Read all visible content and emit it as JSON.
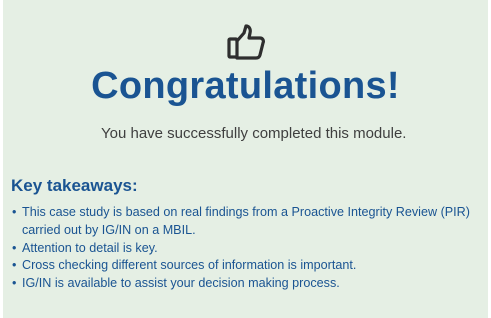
{
  "colors": {
    "panel_background": "#e5efe4",
    "accent": "#1a5492",
    "body_text": "#3f3f3f"
  },
  "icon": {
    "name": "thumbs-up-icon"
  },
  "main": {
    "title": "Congratulations!",
    "subtitle": "You have successfully completed this module."
  },
  "takeaways": {
    "heading": "Key takeaways:",
    "items": [
      "This case study is based on real findings from a Proactive Integrity Review (PIR) carried out by IG/IN on a MBIL.",
      "Attention to detail is key.",
      "Cross checking different sources of information is important.",
      "IG/IN is available to assist your decision making process."
    ]
  }
}
